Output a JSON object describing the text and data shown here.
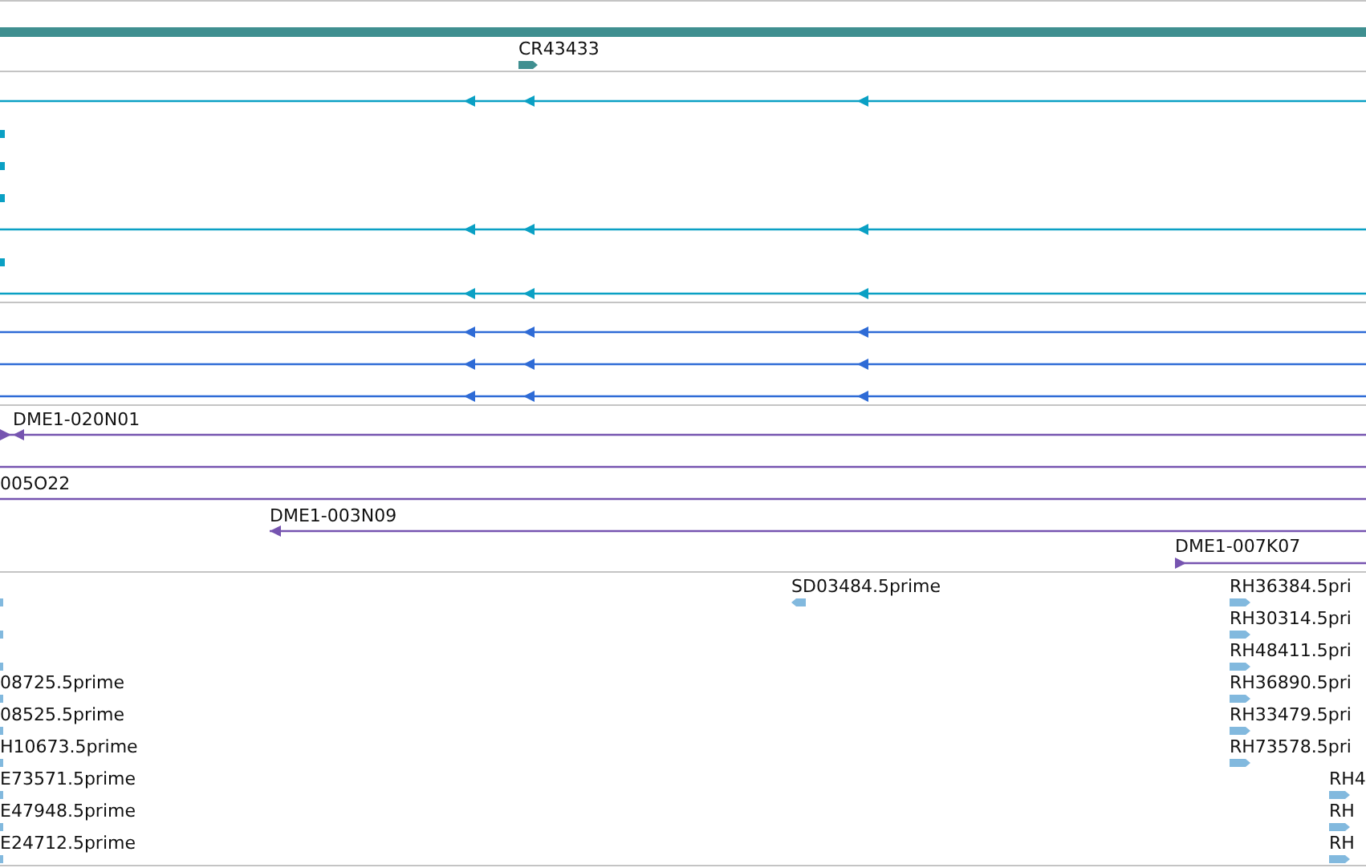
{
  "gene_track": {
    "features": [
      {
        "label": "CR43433"
      }
    ]
  },
  "clone_track": {
    "features": [
      {
        "label": "DME1-020N01"
      },
      {
        "label": "005O22"
      },
      {
        "label": "DME1-003N09"
      },
      {
        "label": "DME1-007K07"
      }
    ]
  },
  "est_track": {
    "features": [
      {
        "label": "SD03484.5prime"
      },
      {
        "label": "RH36384.5pri"
      },
      {
        "label": "RH30314.5pri"
      },
      {
        "label": "RH48411.5pri"
      },
      {
        "label": "RH36890.5pri"
      },
      {
        "label": "RH33479.5pri"
      },
      {
        "label": "RH73578.5pri"
      },
      {
        "label": "RH4"
      },
      {
        "label": "RH"
      },
      {
        "label": "RH"
      },
      {
        "label": "08725.5prime"
      },
      {
        "label": "08525.5prime"
      },
      {
        "label": "H10673.5prime"
      },
      {
        "label": "E73571.5prime"
      },
      {
        "label": "E47948.5prime"
      },
      {
        "label": "E24712.5prime"
      }
    ]
  }
}
